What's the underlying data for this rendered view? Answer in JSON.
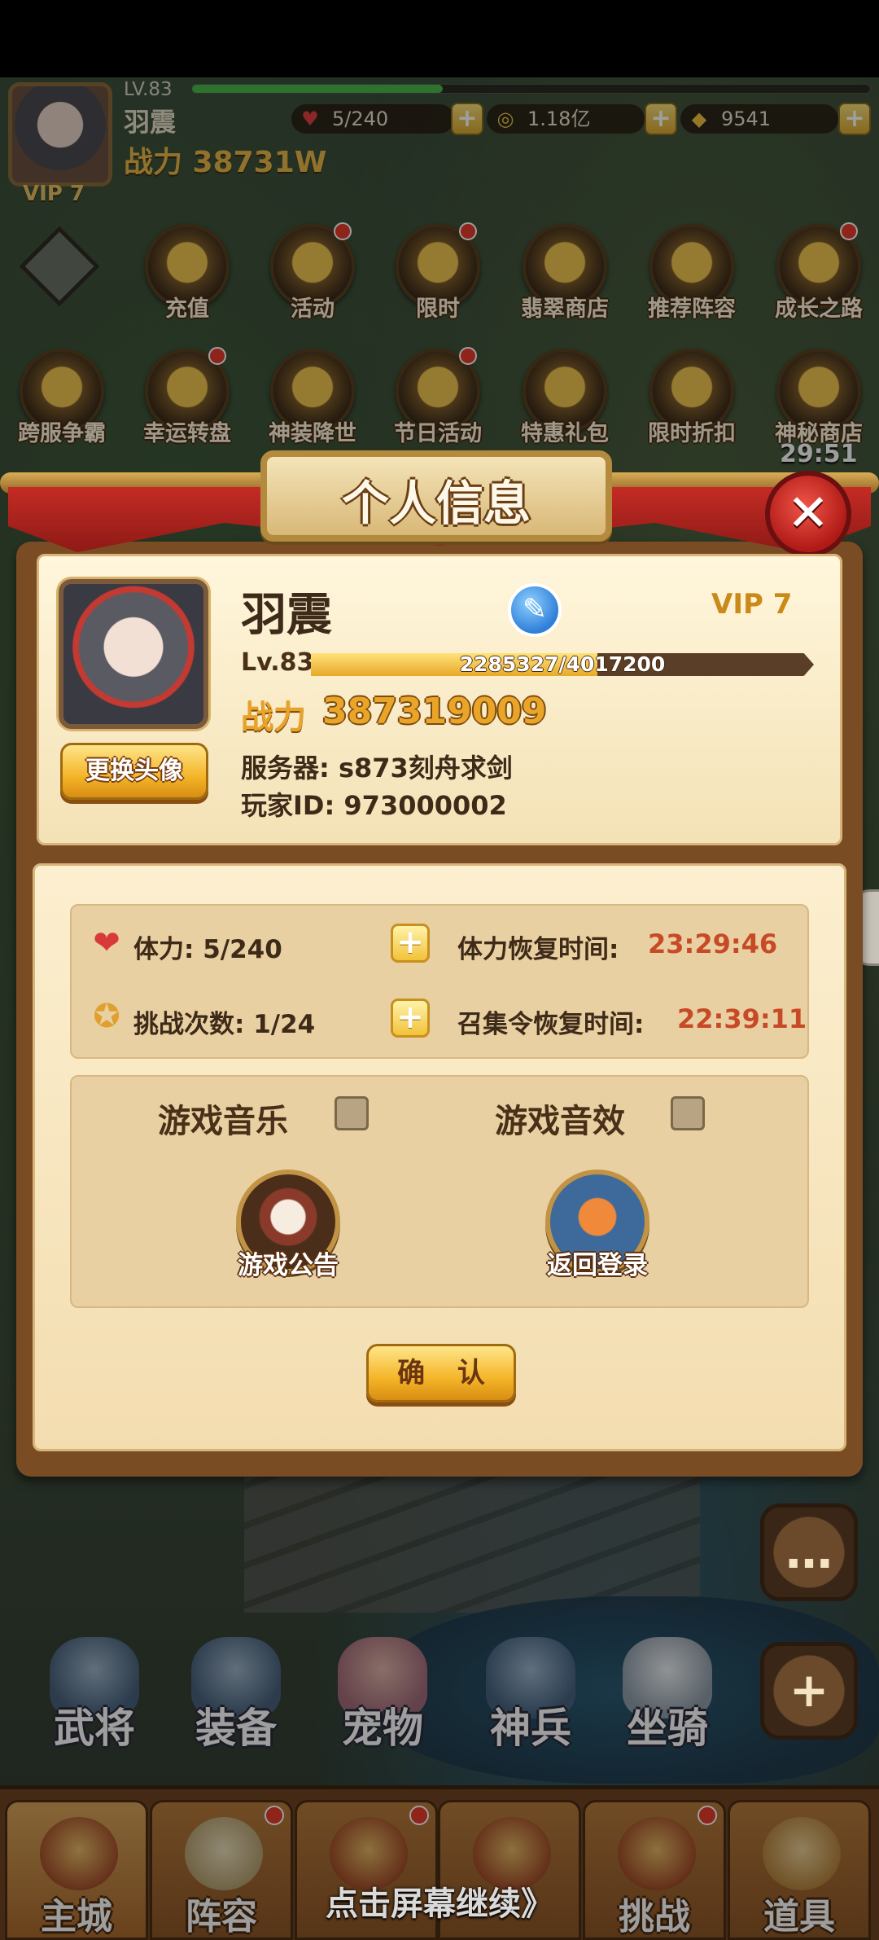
{
  "header": {
    "level": "LV.83",
    "name": "羽震",
    "power": "战力 38731W",
    "vip": "VIP 7",
    "stamina": "5/240",
    "coins": "1.18亿",
    "ingots": "9541"
  },
  "activities_row1": [
    {
      "label": "充值",
      "dot": false
    },
    {
      "label": "活动",
      "dot": true
    },
    {
      "label": "限时",
      "dot": true
    },
    {
      "label": "翡翠商店",
      "dot": false
    },
    {
      "label": "推荐阵容",
      "dot": false
    },
    {
      "label": "成长之路",
      "dot": true
    }
  ],
  "activities_row2": [
    {
      "label": "跨服争霸",
      "dot": false
    },
    {
      "label": "幸运转盘",
      "dot": true
    },
    {
      "label": "神装降世",
      "dot": false
    },
    {
      "label": "节日活动",
      "dot": true
    },
    {
      "label": "特惠礼包",
      "dot": false
    },
    {
      "label": "限时折扣",
      "dot": false
    },
    {
      "label": "神秘商店",
      "dot": false
    }
  ],
  "timer": "29:51",
  "modal": {
    "title": "个人信息",
    "close": "✕",
    "name": "羽震",
    "vip": "VIP 7",
    "level_label": "Lv.83",
    "xp_text": "2285327/4017200",
    "xp_fraction": 0.569,
    "power_label": "战力",
    "power_value": "387319009",
    "change_avatar": "更换头像",
    "server": "服务器:  s873刻舟求剑",
    "player_id": "玩家ID:  973000002",
    "stamina_label": "体力:  5/240",
    "stamina_recover_label": "体力恢复时间:",
    "stamina_recover_time": "23:29:46",
    "challenge_label": "挑战次数:  1/24",
    "summon_recover_label": "召集令恢复时间:",
    "summon_recover_time": "22:39:11",
    "music_label": "游戏音乐",
    "sound_label": "游戏音效",
    "notice_label": "游戏公告",
    "back_login_label": "返回登录",
    "confirm": "确 认"
  },
  "characters": [
    "武将",
    "装备",
    "宠物",
    "神兵",
    "坐骑"
  ],
  "nav": [
    "主城",
    "阵容",
    "",
    "",
    "挑战",
    "道具"
  ],
  "continue_text": "点击屏幕继续》",
  "icons": {
    "stamina": "heart-icon",
    "coin": "coin-icon",
    "ingot": "ingot-icon",
    "challenge": "badge-icon",
    "edit": "pencil-icon",
    "chat": "chat-icon",
    "plus": "plus-icon"
  },
  "colors": {
    "accent_gold": "#f4b528",
    "timer_red": "#c74a26",
    "close_red": "#d2302a"
  }
}
